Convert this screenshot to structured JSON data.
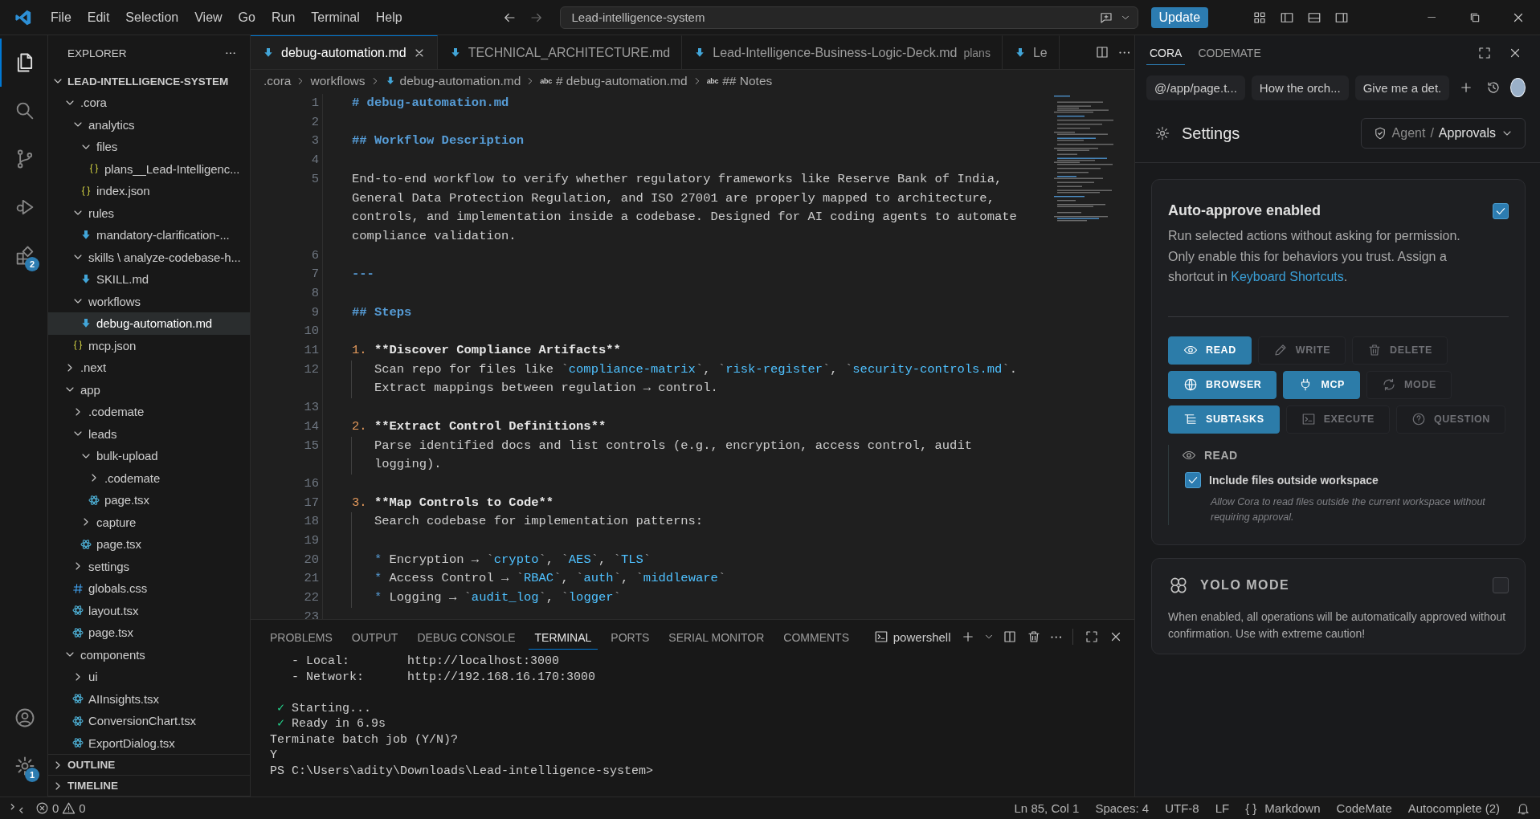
{
  "titlebar": {
    "menu": [
      "File",
      "Edit",
      "Selection",
      "View",
      "Go",
      "Run",
      "Terminal",
      "Help"
    ],
    "search": "Lead-intelligence-system",
    "update_button": "Update"
  },
  "activity_bar": {
    "items": [
      {
        "kind": "files",
        "selected": true
      },
      {
        "kind": "search",
        "selected": false
      },
      {
        "kind": "source-control",
        "selected": false
      },
      {
        "kind": "run-debug",
        "selected": false
      },
      {
        "kind": "extensions",
        "selected": false,
        "badge": "2"
      }
    ],
    "bottom": [
      {
        "kind": "account"
      },
      {
        "kind": "settings",
        "badge": "1"
      }
    ]
  },
  "explorer": {
    "title": "EXPLORER",
    "root": "LEAD-INTELLIGENCE-SYSTEM",
    "tree": [
      {
        "name": ".cora",
        "kind": "folder",
        "expanded": true,
        "selected": false,
        "children": [
          {
            "name": "analytics",
            "kind": "folder",
            "expanded": true,
            "selected": false,
            "children": [
              {
                "name": "files",
                "kind": "folder",
                "expanded": true,
                "selected": false,
                "children": [
                  {
                    "name": "plans__Lead-Intelligenc...",
                    "kind": "json",
                    "selected": false
                  }
                ]
              },
              {
                "name": "index.json",
                "kind": "json",
                "selected": false
              }
            ]
          },
          {
            "name": "rules",
            "kind": "folder",
            "expanded": true,
            "selected": false,
            "children": [
              {
                "name": "mandatory-clarification-...",
                "kind": "md",
                "selected": false
              }
            ]
          },
          {
            "name": "skills \\ analyze-codebase-h...",
            "kind": "folder",
            "expanded": true,
            "selected": false,
            "children": [
              {
                "name": "SKILL.md",
                "kind": "md",
                "selected": false
              }
            ]
          },
          {
            "name": "workflows",
            "kind": "folder",
            "expanded": true,
            "selected": false,
            "children": [
              {
                "name": "debug-automation.md",
                "kind": "md",
                "selected": true
              }
            ]
          },
          {
            "name": "mcp.json",
            "kind": "json",
            "selected": false
          }
        ]
      },
      {
        "name": ".next",
        "kind": "folder",
        "expanded": false,
        "selected": false
      },
      {
        "name": "app",
        "kind": "folder",
        "expanded": true,
        "selected": false,
        "children": [
          {
            "name": ".codemate",
            "kind": "folder",
            "expanded": false,
            "selected": false
          },
          {
            "name": "leads",
            "kind": "folder",
            "expanded": true,
            "selected": false,
            "children": [
              {
                "name": "bulk-upload",
                "kind": "folder",
                "expanded": true,
                "selected": false,
                "children": [
                  {
                    "name": ".codemate",
                    "kind": "folder",
                    "expanded": false,
                    "selected": false
                  },
                  {
                    "name": "page.tsx",
                    "kind": "react",
                    "selected": false
                  }
                ]
              },
              {
                "name": "capture",
                "kind": "folder",
                "expanded": false,
                "selected": false
              },
              {
                "name": "page.tsx",
                "kind": "react",
                "selected": false
              }
            ]
          },
          {
            "name": "settings",
            "kind": "folder",
            "expanded": false,
            "selected": false
          },
          {
            "name": "globals.css",
            "kind": "css",
            "selected": false
          },
          {
            "name": "layout.tsx",
            "kind": "react",
            "selected": false
          },
          {
            "name": "page.tsx",
            "kind": "react",
            "selected": false
          }
        ]
      },
      {
        "name": "components",
        "kind": "folder",
        "expanded": true,
        "selected": false,
        "children": [
          {
            "name": "ui",
            "kind": "folder",
            "expanded": false,
            "selected": false
          },
          {
            "name": "AIInsights.tsx",
            "kind": "react",
            "selected": false
          },
          {
            "name": "ConversionChart.tsx",
            "kind": "react",
            "selected": false
          },
          {
            "name": "ExportDialog.tsx",
            "kind": "react",
            "selected": false
          }
        ]
      }
    ],
    "sections": [
      {
        "label": "OUTLINE",
        "expanded": false
      },
      {
        "label": "TIMELINE",
        "expanded": false
      }
    ]
  },
  "editor": {
    "tabs": [
      {
        "label": "debug-automation.md",
        "selected": true,
        "closable": true
      },
      {
        "label": "TECHNICAL_ARCHITECTURE.md",
        "selected": false,
        "closable": false
      },
      {
        "label": "Lead-Intelligence-Business-Logic-Deck.md",
        "description": "plans",
        "selected": false,
        "closable": false
      },
      {
        "label": "Le",
        "selected": false,
        "closable": false
      }
    ],
    "breadcrumb": [
      {
        "label": ".cora",
        "kind": "folder"
      },
      {
        "label": "workflows",
        "kind": "folder"
      },
      {
        "label": "debug-automation.md",
        "kind": "file"
      },
      {
        "label": "# debug-automation.md",
        "kind": "symbol",
        "symbol": "abc"
      },
      {
        "label": "## Notes",
        "kind": "symbol",
        "symbol": "abc"
      }
    ],
    "lines": [
      {
        "n": "1",
        "indented": false,
        "rows": [
          [
            {
              "kind": "h",
              "text": "# debug-automation.md"
            }
          ]
        ]
      },
      {
        "n": "2",
        "indented": false
      },
      {
        "n": "3",
        "indented": false,
        "rows": [
          [
            {
              "kind": "h",
              "text": "## Workflow Description"
            }
          ]
        ]
      },
      {
        "n": "4",
        "indented": false
      },
      {
        "n": "5",
        "indented": false,
        "rows": [
          [
            {
              "kind": "t",
              "text": "End-to-end workflow to verify whether regulatory frameworks like Reserve Bank of India,"
            }
          ],
          [
            {
              "kind": "t",
              "text": "General Data Protection Regulation, and ISO 27001 are properly mapped to architecture,"
            }
          ],
          [
            {
              "kind": "t",
              "text": "controls, and implementation inside a codebase. Designed for AI coding agents to automate"
            }
          ],
          [
            {
              "kind": "t",
              "text": "compliance validation."
            }
          ]
        ]
      },
      {
        "n": "6",
        "indented": false
      },
      {
        "n": "7",
        "indented": false,
        "rows": [
          [
            {
              "kind": "h",
              "text": "---"
            }
          ]
        ]
      },
      {
        "n": "8",
        "indented": false
      },
      {
        "n": "9",
        "indented": false,
        "rows": [
          [
            {
              "kind": "h",
              "text": "## Steps"
            }
          ]
        ]
      },
      {
        "n": "10",
        "indented": false
      },
      {
        "n": "11",
        "indented": false,
        "rows": [
          [
            {
              "kind": "n",
              "text": "1. "
            },
            {
              "kind": "b",
              "text": "**Discover Compliance Artifacts**"
            }
          ]
        ]
      },
      {
        "n": "12",
        "indented": true,
        "rows": [
          [
            {
              "kind": "t",
              "text": "Scan repo for files like "
            },
            {
              "kind": "p",
              "text": "`"
            },
            {
              "kind": "c",
              "text": "compliance-matrix"
            },
            {
              "kind": "p",
              "text": "`"
            },
            {
              "kind": "t",
              "text": ", "
            },
            {
              "kind": "p",
              "text": "`"
            },
            {
              "kind": "c",
              "text": "risk-register"
            },
            {
              "kind": "p",
              "text": "`"
            },
            {
              "kind": "t",
              "text": ", "
            },
            {
              "kind": "p",
              "text": "`"
            },
            {
              "kind": "c",
              "text": "security-controls.md"
            },
            {
              "kind": "p",
              "text": "`"
            },
            {
              "kind": "t",
              "text": "."
            }
          ],
          [
            {
              "kind": "t",
              "text": "Extract mappings between regulation → control."
            }
          ]
        ]
      },
      {
        "n": "13",
        "indented": false
      },
      {
        "n": "14",
        "indented": false,
        "rows": [
          [
            {
              "kind": "n",
              "text": "2. "
            },
            {
              "kind": "b",
              "text": "**Extract Control Definitions**"
            }
          ]
        ]
      },
      {
        "n": "15",
        "indented": true,
        "rows": [
          [
            {
              "kind": "t",
              "text": "Parse identified docs and list controls (e.g., encryption, access control, audit"
            }
          ],
          [
            {
              "kind": "t",
              "text": "logging)."
            }
          ]
        ]
      },
      {
        "n": "16",
        "indented": false
      },
      {
        "n": "17",
        "indented": false,
        "rows": [
          [
            {
              "kind": "n",
              "text": "3. "
            },
            {
              "kind": "b",
              "text": "**Map Controls to Code**"
            }
          ]
        ]
      },
      {
        "n": "18",
        "indented": true,
        "rows": [
          [
            {
              "kind": "t",
              "text": "Search codebase for implementation patterns:"
            }
          ]
        ]
      },
      {
        "n": "19",
        "indented": true
      },
      {
        "n": "20",
        "indented": true,
        "rows": [
          [
            {
              "kind": "s",
              "text": "* "
            },
            {
              "kind": "t",
              "text": "Encryption → "
            },
            {
              "kind": "p",
              "text": "`"
            },
            {
              "kind": "c",
              "text": "crypto"
            },
            {
              "kind": "p",
              "text": "`"
            },
            {
              "kind": "t",
              "text": ", "
            },
            {
              "kind": "p",
              "text": "`"
            },
            {
              "kind": "c",
              "text": "AES"
            },
            {
              "kind": "p",
              "text": "`"
            },
            {
              "kind": "t",
              "text": ", "
            },
            {
              "kind": "p",
              "text": "`"
            },
            {
              "kind": "c",
              "text": "TLS"
            },
            {
              "kind": "p",
              "text": "`"
            }
          ]
        ]
      },
      {
        "n": "21",
        "indented": true,
        "rows": [
          [
            {
              "kind": "s",
              "text": "* "
            },
            {
              "kind": "t",
              "text": "Access Control → "
            },
            {
              "kind": "p",
              "text": "`"
            },
            {
              "kind": "c",
              "text": "RBAC"
            },
            {
              "kind": "p",
              "text": "`"
            },
            {
              "kind": "t",
              "text": ", "
            },
            {
              "kind": "p",
              "text": "`"
            },
            {
              "kind": "c",
              "text": "auth"
            },
            {
              "kind": "p",
              "text": "`"
            },
            {
              "kind": "t",
              "text": ", "
            },
            {
              "kind": "p",
              "text": "`"
            },
            {
              "kind": "c",
              "text": "middleware"
            },
            {
              "kind": "p",
              "text": "`"
            }
          ]
        ]
      },
      {
        "n": "22",
        "indented": true,
        "rows": [
          [
            {
              "kind": "s",
              "text": "* "
            },
            {
              "kind": "t",
              "text": "Logging → "
            },
            {
              "kind": "p",
              "text": "`"
            },
            {
              "kind": "c",
              "text": "audit_log"
            },
            {
              "kind": "p",
              "text": "`"
            },
            {
              "kind": "t",
              "text": ", "
            },
            {
              "kind": "p",
              "text": "`"
            },
            {
              "kind": "c",
              "text": "logger"
            },
            {
              "kind": "p",
              "text": "`"
            }
          ]
        ]
      },
      {
        "n": "23",
        "indented": false
      }
    ]
  },
  "panel": {
    "tabs": [
      {
        "label": "PROBLEMS",
        "selected": false
      },
      {
        "label": "OUTPUT",
        "selected": false
      },
      {
        "label": "DEBUG CONSOLE",
        "selected": false
      },
      {
        "label": "TERMINAL",
        "selected": true
      },
      {
        "label": "PORTS",
        "selected": false
      },
      {
        "label": "SERIAL MONITOR",
        "selected": false
      },
      {
        "label": "COMMENTS",
        "selected": false
      }
    ],
    "shell": "powershell",
    "lines": [
      {
        "text": "   - Local:        http://localhost:3000",
        "spaced": false
      },
      {
        "text": "   - Network:      http://192.168.16.170:3000",
        "spaced": false
      },
      {
        "prefix": " ✓ ",
        "text": "Starting...",
        "spaced": true
      },
      {
        "prefix": " ✓ ",
        "text": "Ready in 6.9s",
        "spaced": false
      },
      {
        "text": "Terminate batch job (Y/N)?",
        "spaced": false
      },
      {
        "text": "Y",
        "spaced": false
      },
      {
        "text": "PS C:\\Users\\adity\\Downloads\\Lead-intelligence-system>",
        "spaced": false
      }
    ]
  },
  "assistant": {
    "tabs": [
      {
        "label": "CORA",
        "selected": true
      },
      {
        "label": "CODEMATE",
        "selected": false
      }
    ],
    "chips": [
      "@/app/page.t...",
      "How the orch...",
      "Give me a det."
    ],
    "settings": {
      "title": "Settings",
      "scope": "Agent",
      "separator": "/",
      "page": "Approvals"
    },
    "auto_approve": {
      "title": "Auto-approve enabled",
      "checked": true,
      "description": "Run selected actions without asking for permission. Only enable this for behaviors you trust. Assign a shortcut in ",
      "link": "Keyboard Shortcuts",
      "after": "."
    },
    "permission_rows": [
      {
        "buttons": [
          {
            "label": "READ",
            "kind": "read",
            "on": true
          },
          {
            "label": "WRITE",
            "kind": "write",
            "on": false
          },
          {
            "label": "DELETE",
            "kind": "delete",
            "on": false
          }
        ]
      },
      {
        "buttons": [
          {
            "label": "BROWSER",
            "kind": "browser",
            "on": true
          },
          {
            "label": "MCP",
            "kind": "mcp",
            "on": true
          },
          {
            "label": "MODE",
            "kind": "mode",
            "on": false
          }
        ]
      },
      {
        "buttons": [
          {
            "label": "SUBTASKS",
            "kind": "subtasks",
            "on": true
          },
          {
            "label": "EXECUTE",
            "kind": "execute",
            "on": false
          },
          {
            "label": "QUESTION",
            "kind": "question",
            "on": false
          }
        ]
      }
    ],
    "detail": {
      "label": "READ",
      "kind": "read",
      "option": {
        "label": "Include files outside workspace",
        "checked": true,
        "hint": "Allow Cora to read files outside the current workspace without requiring approval."
      }
    },
    "yolo": {
      "title": "YOLO MODE",
      "checked": false,
      "description": "When enabled, all operations will be automatically approved without confirmation. Use with extreme caution!"
    }
  },
  "status_bar": {
    "errors": "0",
    "warnings": "0",
    "items": [
      {
        "label": "Ln 85, Col 1"
      },
      {
        "label": "Spaces: 4"
      },
      {
        "label": "UTF-8"
      },
      {
        "label": "LF"
      },
      {
        "prefix": "{ }",
        "label": "Markdown"
      },
      {
        "label": "CodeMate"
      },
      {
        "label": "Autocomplete (2)"
      }
    ]
  }
}
